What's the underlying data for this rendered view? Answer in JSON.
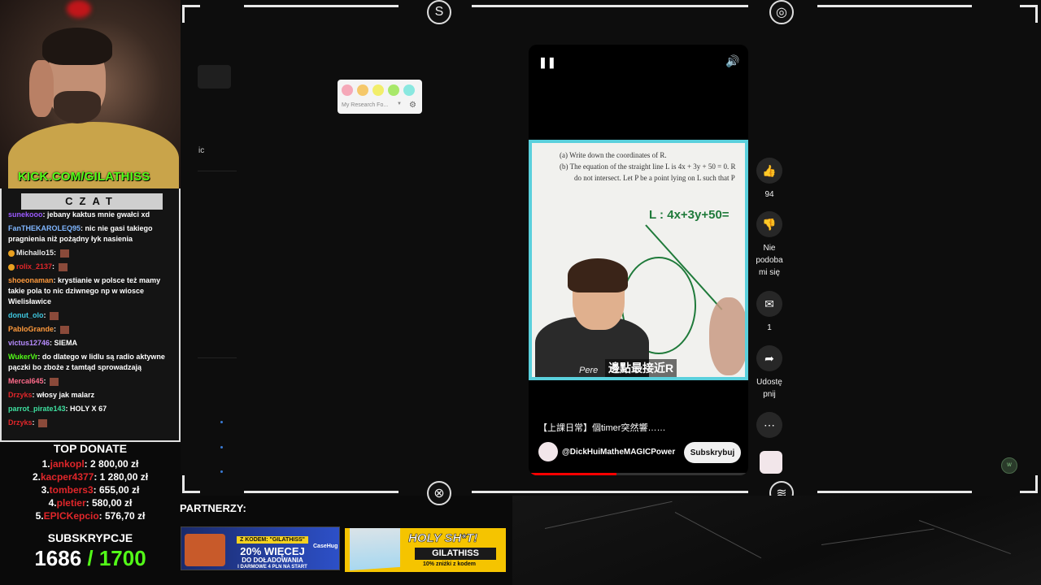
{
  "stream": {
    "kick_channel": "KICK.COM/GILATHISS",
    "chat_title": "CZAT"
  },
  "chat": {
    "messages": [
      {
        "user": "sunekooo",
        "text": "jebany kaktus mnie gwałci xd",
        "color": "#9b59ff",
        "badge": false,
        "emote": false
      },
      {
        "user": "FanTHEKAROLEQ95",
        "text": "nic nie gasi takiego pragnienia niż pożądny łyk nasienia",
        "color": "#7fb6ff",
        "badge": false,
        "emote": false
      },
      {
        "user": "Michallo15",
        "text": "",
        "color": "#e8e8e8",
        "badge": true,
        "emote": true
      },
      {
        "user": "rolix_2137",
        "text": "",
        "color": "#e0262a",
        "badge": true,
        "emote": true
      },
      {
        "user": "shoeonaman",
        "text": "krystianie w polsce też mamy takie pola to nic dziwnego np w wiosce Wielisławice",
        "color": "#ff9a3c",
        "badge": false,
        "emote": false
      },
      {
        "user": "donut_olo",
        "text": "",
        "color": "#3ec7e0",
        "badge": false,
        "emote": true
      },
      {
        "user": "PabloGrande",
        "text": "",
        "color": "#ff9a3c",
        "badge": false,
        "emote": true
      },
      {
        "user": "victus12746",
        "text": "SIEMA",
        "color": "#b78cff",
        "badge": false,
        "emote": false
      },
      {
        "user": "WukerVr",
        "text": "do dlatego w lidlu są radio aktywne pączki bo zboże z tamtąd sprowadzają",
        "color": "#53fc18",
        "badge": false,
        "emote": false
      },
      {
        "user": "Mercal645",
        "text": "",
        "color": "#ff6b8a",
        "badge": false,
        "emote": true
      },
      {
        "user": "Drzyks",
        "text": "włosy jak malarz",
        "color": "#e0262a",
        "badge": false,
        "emote": false
      },
      {
        "user": "parrot_pirate143",
        "text": "HOLY X 67",
        "color": "#3ee0a0",
        "badge": false,
        "emote": false
      },
      {
        "user": "Drzyks",
        "text": "",
        "color": "#e0262a",
        "badge": false,
        "emote": true
      }
    ]
  },
  "donations": {
    "title": "TOP DONATE",
    "items": [
      {
        "rank": "1.",
        "name": "jankopl",
        "amount": ": 2 800,00 zł"
      },
      {
        "rank": "2.",
        "name": "kacper4377",
        "amount": ": 1 280,00 zł"
      },
      {
        "rank": "3.",
        "name": "tombers3",
        "amount": ": 655,00 zł"
      },
      {
        "rank": "4.",
        "name": "pletier",
        "amount": ": 580,00 zł"
      },
      {
        "rank": "5.",
        "name": "EPICKepcio",
        "amount": ": 576,70 zł"
      }
    ]
  },
  "subscriptions": {
    "title": "SUBSKRYPCJE",
    "current": "1686",
    "goal": "/ 1700"
  },
  "partners": {
    "label": "PARTNERZY:",
    "banner1": {
      "code": "Z KODEM: \"GILATHISS\"",
      "headline": "20% WIĘCEJ",
      "sub": "DO DOŁADOWANIA",
      "small": "I DARMOWE 4 PLN NA START",
      "brand": "CaseHug"
    },
    "banner2": {
      "title": "HOLY SH*T!",
      "code": "GILATHISS",
      "small": "10% zniżki z kodem"
    }
  },
  "browser": {
    "sidebar_text": "ic",
    "color_widget": {
      "label": "My Research Fo...",
      "colors": [
        "#f5a8b8",
        "#f5c86a",
        "#f2ee6a",
        "#a8e86a",
        "#8ae8e0"
      ]
    }
  },
  "short": {
    "question_a": "(a)   Write down the coordinates of R.",
    "question_b": "(b)   The equation of the straight line L is 4x + 3y + 50 = 0. R",
    "question_b2": "do not intersect. Let P be a point lying on L such that P",
    "board_math": "L : 4x+3y+50=",
    "caption": "邊點最接近R",
    "caption_left": "Pere",
    "title": "【上課日常】個timer突然響……",
    "channel": "@DickHuiMatheMAGICPower",
    "subscribe_label": "Subskrybuj",
    "progress": 0.4
  },
  "actions": {
    "likes": "94",
    "dislike_label": "Nie podoba mi się",
    "comments": "1",
    "share_label": "Udostę pnij"
  }
}
